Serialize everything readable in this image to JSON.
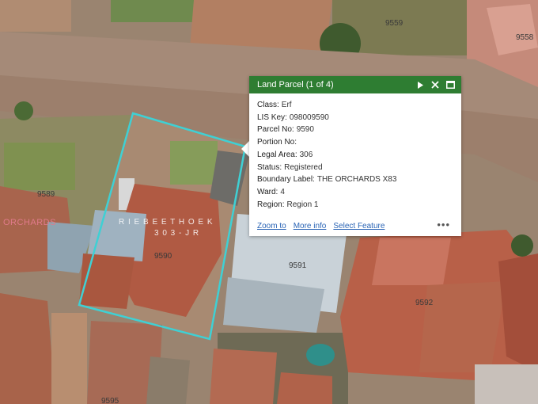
{
  "map": {
    "parcel_labels": {
      "p9559": "9559",
      "p9558": "9558",
      "p9589": "9589",
      "p9590": "9590",
      "p9591": "9591",
      "p9592": "9592",
      "p9595": "9595"
    },
    "suburb_label": "ORCHARDS",
    "ghost_text_1": "R I E B E E T H O E K",
    "ghost_text_2": "3 0 3 - J R",
    "colors": {
      "selection_outline": "#3fd0d4",
      "popup_header": "#2e7d32",
      "link": "#2a64b5"
    }
  },
  "popup": {
    "title": "Land Parcel (1 of 4)",
    "header_icons": [
      "play-icon",
      "close-icon",
      "maximize-icon"
    ],
    "fields": [
      {
        "key": "Class:",
        "value": "Erf"
      },
      {
        "key": "LIS Key:",
        "value": "098009590"
      },
      {
        "key": "Parcel No:",
        "value": "9590"
      },
      {
        "key": "Portion No:",
        "value": ""
      },
      {
        "key": "Legal Area:",
        "value": "306"
      },
      {
        "key": "Status:",
        "value": "Registered"
      },
      {
        "key": "Boundary Label:",
        "value": "THE ORCHARDS X83"
      },
      {
        "key": "Ward:",
        "value": "4"
      },
      {
        "key": "Region:",
        "value": "Region 1"
      }
    ],
    "actions": {
      "zoom_to": "Zoom to",
      "more_info": "More info",
      "select_feature": "Select Feature"
    },
    "more_icon": "•••"
  }
}
